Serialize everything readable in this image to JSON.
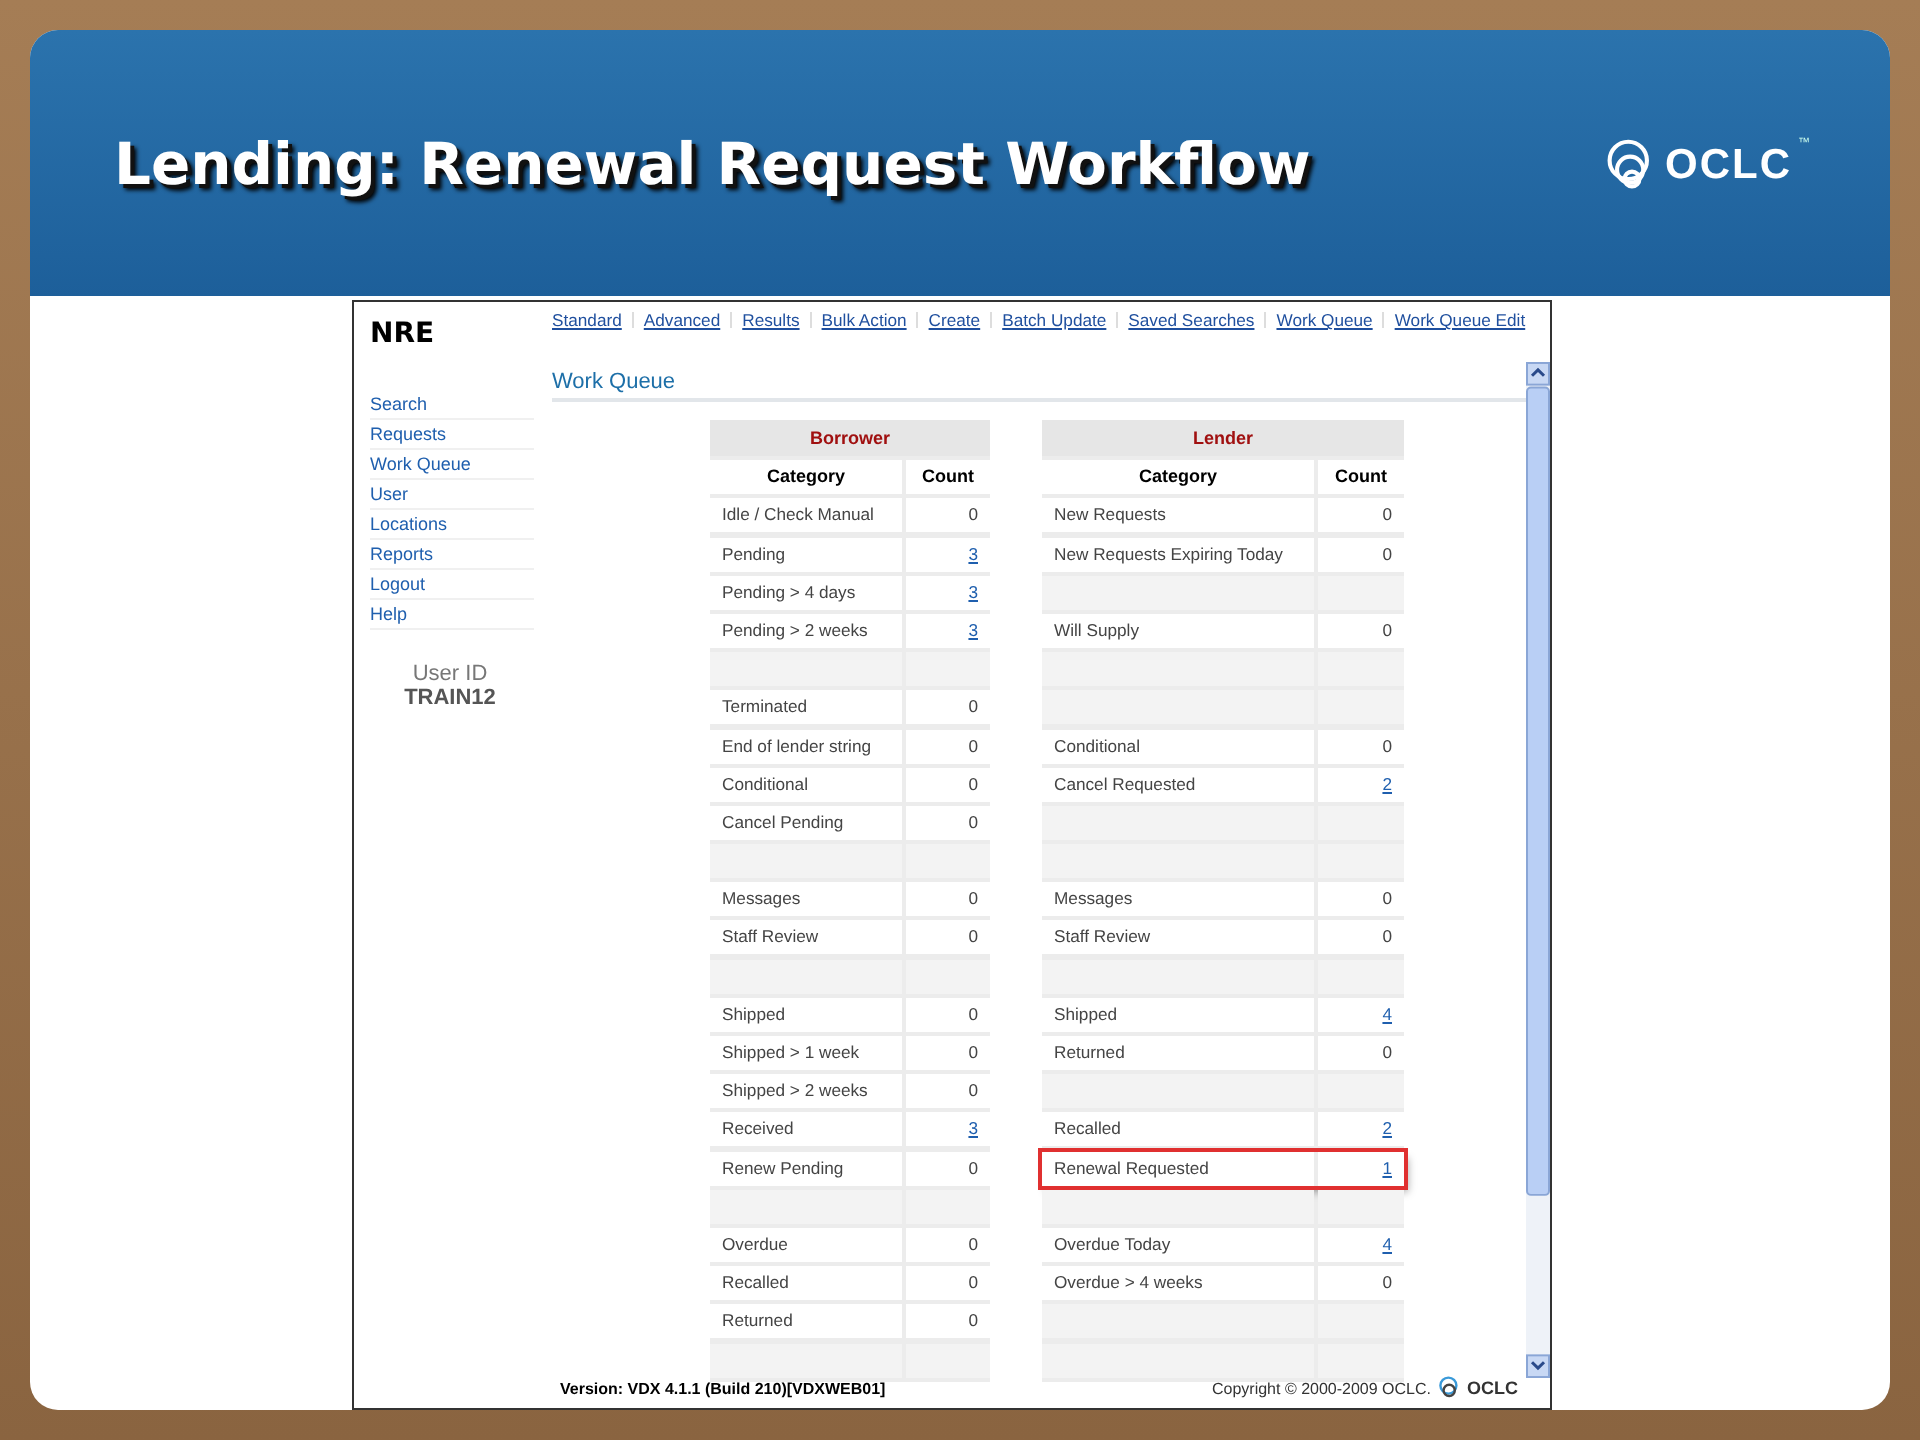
{
  "slide": {
    "title": "Lending: Renewal Request Workflow",
    "logo_text": "OCLC",
    "logo_mark": "™"
  },
  "app": {
    "brand": "NRE",
    "top_nav": [
      {
        "label": "Standard"
      },
      {
        "label": "Advanced"
      },
      {
        "label": "Results"
      },
      {
        "label": "Bulk Action"
      },
      {
        "label": "Create"
      },
      {
        "label": "Batch Update"
      },
      {
        "label": "Saved Searches"
      },
      {
        "label": "Work Queue"
      },
      {
        "label": "Work Queue Edit"
      }
    ],
    "side_nav": [
      {
        "label": "Search"
      },
      {
        "label": "Requests"
      },
      {
        "label": "Work Queue"
      },
      {
        "label": "User"
      },
      {
        "label": "Locations"
      },
      {
        "label": "Reports"
      },
      {
        "label": "Logout"
      },
      {
        "label": "Help"
      }
    ],
    "user_id_label": "User ID",
    "user_id": "TRAIN12",
    "heading": "Work Queue",
    "tables": [
      {
        "title": "Borrower",
        "columns": [
          "Category",
          "Count"
        ],
        "rows": [
          {
            "kind": "item",
            "category": "Idle / Check Manual",
            "count": "0",
            "link": false,
            "highlighted": false
          },
          {
            "kind": "item",
            "category": "Pending",
            "count": "3",
            "link": true,
            "highlighted": false
          },
          {
            "kind": "item",
            "category": "Pending > 4 days",
            "count": "3",
            "link": true,
            "highlighted": false
          },
          {
            "kind": "item",
            "category": "Pending > 2 weeks",
            "count": "3",
            "link": true,
            "highlighted": false
          },
          {
            "kind": "blank"
          },
          {
            "kind": "item",
            "category": "Terminated",
            "count": "0",
            "link": false,
            "highlighted": false
          },
          {
            "kind": "item",
            "category": "End of lender string",
            "count": "0",
            "link": false,
            "highlighted": false
          },
          {
            "kind": "item",
            "category": "Conditional",
            "count": "0",
            "link": false,
            "highlighted": false
          },
          {
            "kind": "item",
            "category": "Cancel Pending",
            "count": "0",
            "link": false,
            "highlighted": false
          },
          {
            "kind": "blank"
          },
          {
            "kind": "item",
            "category": "Messages",
            "count": "0",
            "link": false,
            "highlighted": false
          },
          {
            "kind": "item",
            "category": "Staff Review",
            "count": "0",
            "link": false,
            "highlighted": false
          },
          {
            "kind": "blank"
          },
          {
            "kind": "item",
            "category": "Shipped",
            "count": "0",
            "link": false,
            "highlighted": false
          },
          {
            "kind": "item",
            "category": "Shipped > 1 week",
            "count": "0",
            "link": false,
            "highlighted": false
          },
          {
            "kind": "item",
            "category": "Shipped > 2 weeks",
            "count": "0",
            "link": false,
            "highlighted": false
          },
          {
            "kind": "item",
            "category": "Received",
            "count": "3",
            "link": true,
            "highlighted": false
          },
          {
            "kind": "item",
            "category": "Renew Pending",
            "count": "0",
            "link": false,
            "highlighted": false
          },
          {
            "kind": "blank"
          },
          {
            "kind": "item",
            "category": "Overdue",
            "count": "0",
            "link": false,
            "highlighted": false
          },
          {
            "kind": "item",
            "category": "Recalled",
            "count": "0",
            "link": false,
            "highlighted": false
          },
          {
            "kind": "item",
            "category": "Returned",
            "count": "0",
            "link": false,
            "highlighted": false
          },
          {
            "kind": "blank"
          }
        ]
      },
      {
        "title": "Lender",
        "columns": [
          "Category",
          "Count"
        ],
        "rows": [
          {
            "kind": "item",
            "category": "New Requests",
            "count": "0",
            "link": false,
            "highlighted": false
          },
          {
            "kind": "item",
            "category": "New Requests Expiring Today",
            "count": "0",
            "link": false,
            "highlighted": false
          },
          {
            "kind": "blank"
          },
          {
            "kind": "item",
            "category": "Will Supply",
            "count": "0",
            "link": false,
            "highlighted": false
          },
          {
            "kind": "blank"
          },
          {
            "kind": "blank"
          },
          {
            "kind": "item",
            "category": "Conditional",
            "count": "0",
            "link": false,
            "highlighted": false
          },
          {
            "kind": "item",
            "category": "Cancel Requested",
            "count": "2",
            "link": true,
            "highlighted": false
          },
          {
            "kind": "blank"
          },
          {
            "kind": "blank"
          },
          {
            "kind": "item",
            "category": "Messages",
            "count": "0",
            "link": false,
            "highlighted": false
          },
          {
            "kind": "item",
            "category": "Staff Review",
            "count": "0",
            "link": false,
            "highlighted": false
          },
          {
            "kind": "blank"
          },
          {
            "kind": "item",
            "category": "Shipped",
            "count": "4",
            "link": true,
            "highlighted": false
          },
          {
            "kind": "item",
            "category": "Returned",
            "count": "0",
            "link": false,
            "highlighted": false
          },
          {
            "kind": "blank"
          },
          {
            "kind": "item",
            "category": "Recalled",
            "count": "2",
            "link": true,
            "highlighted": false
          },
          {
            "kind": "item",
            "category": "Renewal Requested",
            "count": "1",
            "link": true,
            "highlighted": true
          },
          {
            "kind": "blank"
          },
          {
            "kind": "item",
            "category": "Overdue Today",
            "count": "4",
            "link": true,
            "highlighted": false
          },
          {
            "kind": "item",
            "category": "Overdue > 4 weeks",
            "count": "0",
            "link": false,
            "highlighted": false
          },
          {
            "kind": "blank"
          },
          {
            "kind": "blank"
          }
        ]
      }
    ],
    "footer": {
      "version": "Version: VDX 4.1.1 (Build 210)[VDXWEB01]",
      "copyright": "Copyright © 2000-2009 OCLC.",
      "logo_text": "OCLC"
    }
  }
}
